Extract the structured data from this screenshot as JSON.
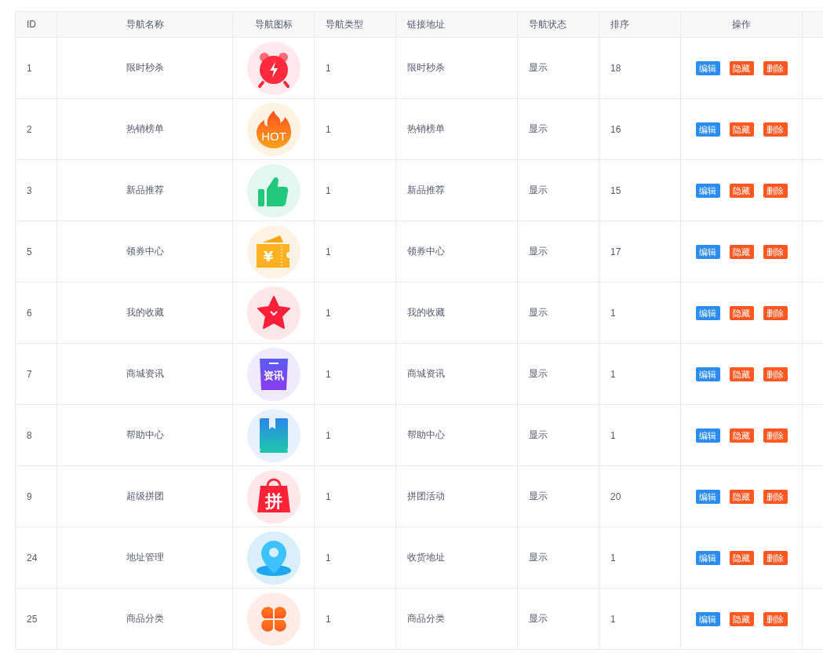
{
  "table": {
    "columns": [
      "ID",
      "导航名称",
      "导航图标",
      "导航类型",
      "链接地址",
      "导航状态",
      "排序",
      "操作"
    ],
    "rows": [
      {
        "id": "1",
        "name": "限时秒杀",
        "icon": {
          "kind": "alarm"
        },
        "type": "1",
        "link": "限时秒杀",
        "status": "显示",
        "sort": "18",
        "actions": [
          {
            "label": "编辑",
            "kind": "primary"
          },
          {
            "label": "隐藏",
            "kind": "warn"
          },
          {
            "label": "删除",
            "kind": "warn"
          }
        ]
      },
      {
        "id": "2",
        "name": "热销榜单",
        "icon": {
          "kind": "fire",
          "text": "HOT"
        },
        "type": "1",
        "link": "热销榜单",
        "status": "显示",
        "sort": "16",
        "actions": [
          {
            "label": "编辑",
            "kind": "primary"
          },
          {
            "label": "隐藏",
            "kind": "warn"
          },
          {
            "label": "删除",
            "kind": "warn"
          }
        ]
      },
      {
        "id": "3",
        "name": "新品推荐",
        "icon": {
          "kind": "thumb"
        },
        "type": "1",
        "link": "新品推荐",
        "status": "显示",
        "sort": "15",
        "actions": [
          {
            "label": "编辑",
            "kind": "primary"
          },
          {
            "label": "隐藏",
            "kind": "warn"
          },
          {
            "label": "删除",
            "kind": "warn"
          }
        ]
      },
      {
        "id": "5",
        "name": "领券中心",
        "icon": {
          "kind": "coupon",
          "text": "¥"
        },
        "type": "1",
        "link": "领券中心",
        "status": "显示",
        "sort": "17",
        "actions": [
          {
            "label": "编辑",
            "kind": "primary"
          },
          {
            "label": "隐藏",
            "kind": "warn"
          },
          {
            "label": "删除",
            "kind": "warn"
          }
        ]
      },
      {
        "id": "6",
        "name": "我的收藏",
        "icon": {
          "kind": "star"
        },
        "type": "1",
        "link": "我的收藏",
        "status": "显示",
        "sort": "1",
        "actions": [
          {
            "label": "编辑",
            "kind": "primary"
          },
          {
            "label": "隐藏",
            "kind": "warn"
          },
          {
            "label": "删除",
            "kind": "warn"
          }
        ]
      },
      {
        "id": "7",
        "name": "商城资讯",
        "icon": {
          "kind": "news",
          "text": "资讯"
        },
        "type": "1",
        "link": "商城资讯",
        "status": "显示",
        "sort": "1",
        "actions": [
          {
            "label": "编辑",
            "kind": "primary"
          },
          {
            "label": "隐藏",
            "kind": "warn"
          },
          {
            "label": "删除",
            "kind": "warn"
          }
        ]
      },
      {
        "id": "8",
        "name": "帮助中心",
        "icon": {
          "kind": "book"
        },
        "type": "1",
        "link": "帮助中心",
        "status": "显示",
        "sort": "1",
        "actions": [
          {
            "label": "编辑",
            "kind": "primary"
          },
          {
            "label": "隐藏",
            "kind": "warn"
          },
          {
            "label": "删除",
            "kind": "warn"
          }
        ]
      },
      {
        "id": "9",
        "name": "超级拼团",
        "icon": {
          "kind": "bag",
          "text": "拼"
        },
        "type": "1",
        "link": "拼团活动",
        "status": "显示",
        "sort": "20",
        "actions": [
          {
            "label": "编辑",
            "kind": "primary"
          },
          {
            "label": "隐藏",
            "kind": "warn"
          },
          {
            "label": "删除",
            "kind": "warn"
          }
        ]
      },
      {
        "id": "24",
        "name": "地址管理",
        "icon": {
          "kind": "pin"
        },
        "type": "1",
        "link": "收货地址",
        "status": "显示",
        "sort": "1",
        "actions": [
          {
            "label": "编辑",
            "kind": "primary"
          },
          {
            "label": "隐藏",
            "kind": "warn"
          },
          {
            "label": "删除",
            "kind": "warn"
          }
        ]
      },
      {
        "id": "25",
        "name": "商品分类",
        "icon": {
          "kind": "clover"
        },
        "type": "1",
        "link": "商品分类",
        "status": "显示",
        "sort": "1",
        "actions": [
          {
            "label": "编辑",
            "kind": "primary"
          },
          {
            "label": "隐藏",
            "kind": "warn"
          },
          {
            "label": "删除",
            "kind": "warn"
          }
        ]
      }
    ]
  }
}
